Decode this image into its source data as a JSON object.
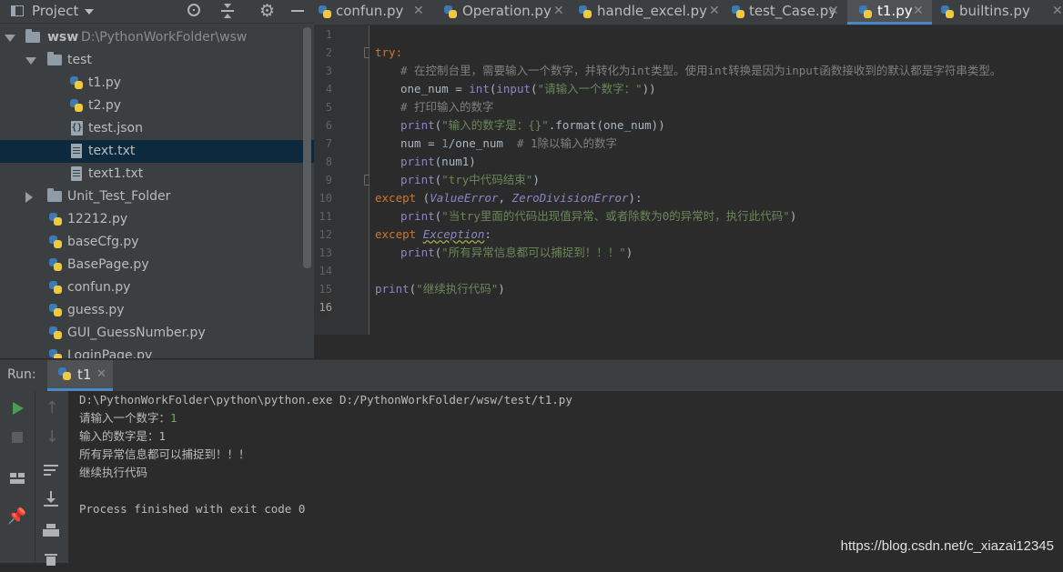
{
  "project_panel": {
    "title": "Project",
    "tree": [
      {
        "name": "wsw",
        "path": "D:\\PythonWorkFolder\\wsw",
        "type": "folder",
        "expanded": true
      },
      {
        "name": "test",
        "type": "folder",
        "expanded": true
      },
      {
        "name": "t1.py",
        "type": "py"
      },
      {
        "name": "t2.py",
        "type": "py"
      },
      {
        "name": "test.json",
        "type": "json"
      },
      {
        "name": "text.txt",
        "type": "txt",
        "selected": true
      },
      {
        "name": "text1.txt",
        "type": "txt"
      },
      {
        "name": "Unit_Test_Folder",
        "type": "folder",
        "expanded": false
      },
      {
        "name": "12212.py",
        "type": "py"
      },
      {
        "name": "baseCfg.py",
        "type": "py"
      },
      {
        "name": "BasePage.py",
        "type": "py"
      },
      {
        "name": "confun.py",
        "type": "py"
      },
      {
        "name": "guess.py",
        "type": "py"
      },
      {
        "name": "GUI_GuessNumber.py",
        "type": "py"
      },
      {
        "name": "LoginPage.py",
        "type": "py"
      }
    ]
  },
  "editor_tabs": [
    {
      "label": "confun.py"
    },
    {
      "label": "Operation.py"
    },
    {
      "label": "handle_excel.py"
    },
    {
      "label": "test_Case.py"
    },
    {
      "label": "t1.py",
      "active": true
    },
    {
      "label": "builtins.py"
    }
  ],
  "editor": {
    "line_numbers": [
      "1",
      "2",
      "3",
      "4",
      "5",
      "6",
      "7",
      "8",
      "9",
      "10",
      "11",
      "12",
      "13",
      "14",
      "15",
      "16"
    ],
    "current_line": "16",
    "code": {
      "l2_kw": "try",
      "l2_colon": ":",
      "l3_cmt": "# 在控制台里，需要输入一个数字，并转化为int类型。使用int转换是因为input函数接收到的默认都是字符串类型。",
      "l4_a": "one_num = ",
      "l4_int": "int",
      "l4_b": "(",
      "l4_input": "input",
      "l4_c": "(",
      "l4_str": "\"请输入一个数字：\"",
      "l4_d": "))",
      "l5_cmt": "# 打印输入的数字",
      "l6_print": "print",
      "l6_a": "(",
      "l6_str": "\"输入的数字是：{}\"",
      "l6_b": ".format(one_num))",
      "l7_a": "num = ",
      "l7_num": "1",
      "l7_b": "/one_num  ",
      "l7_cmt": "# 1除以输入的数字",
      "l8_print": "print",
      "l8_a": "(num1)",
      "l9_print": "print",
      "l9_a": "(",
      "l9_str": "\"try中代码结束\"",
      "l9_b": ")",
      "l10_kw": "except",
      "l10_a": " (",
      "l10_e1": "ValueError",
      "l10_b": ", ",
      "l10_e2": "ZeroDivisionError",
      "l10_c": "):",
      "l11_print": "print",
      "l11_a": "(",
      "l11_str": "\"当try里面的代码出现值异常、或者除数为0的异常时，执行此代码\"",
      "l11_b": ")",
      "l12_kw": "except",
      "l12_a": " ",
      "l12_e": "Exception",
      "l12_b": ":",
      "l13_print": "print",
      "l13_a": "(",
      "l13_str": "\"所有异常信息都可以捕捉到！！！\"",
      "l13_b": ")",
      "l15_print": "print",
      "l15_a": "(",
      "l15_str": "\"继续执行代码\"",
      "l15_b": ")"
    }
  },
  "run_panel": {
    "label": "Run:",
    "tab": "t1",
    "console": [
      "D:\\PythonWorkFolder\\python\\python.exe D:/PythonWorkFolder/wsw/test/t1.py",
      "请输入一个数字：",
      "输入的数字是：1",
      "所有异常信息都可以捕捉到！！！",
      "继续执行代码",
      "",
      "Process finished with exit code 0"
    ],
    "input_echo": "1"
  },
  "watermark": "https://blog.csdn.net/c_xiazai12345",
  "colors": {
    "keyword": "#cc7832",
    "string": "#6a8759",
    "number": "#6897bb",
    "comment": "#808080",
    "builtin": "#8888c6",
    "selection": "#0d293e",
    "run_green": "#499c54"
  }
}
